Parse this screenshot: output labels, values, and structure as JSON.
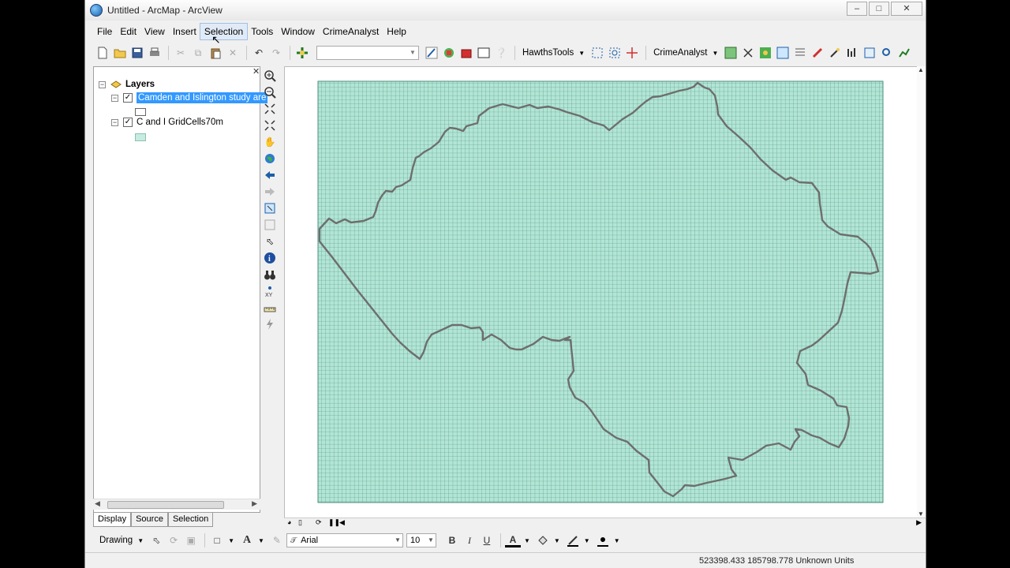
{
  "window": {
    "title": "Untitled - ArcMap - ArcView"
  },
  "menu": [
    "File",
    "Edit",
    "View",
    "Insert",
    "Selection",
    "Tools",
    "Window",
    "CrimeAnalyst",
    "Help"
  ],
  "toolbar": {
    "hawths_label": "HawthsTools",
    "crime_label": "CrimeAnalyst"
  },
  "toc": {
    "root": "Layers",
    "layers": [
      {
        "name": "Camden and Islington study are",
        "checked": true,
        "selected": true,
        "symbol": "outline"
      },
      {
        "name": "C and I GridCells70m",
        "checked": true,
        "selected": false,
        "symbol": "#c6ebe0"
      }
    ],
    "tabs": [
      "Display",
      "Source",
      "Selection"
    ]
  },
  "map": {
    "grid_fill": "#b2e5d5",
    "grid_line": "#4d8e7c",
    "boundary_color": "#6e6e6e"
  },
  "drawing": {
    "drawing_label": "Drawing",
    "font_name": "Arial",
    "font_size": "10",
    "bold": "B",
    "italic": "I",
    "underline": "U",
    "font_color_glyph": "A"
  },
  "status": {
    "coords": "523398.433  185798.778 Unknown Units"
  }
}
